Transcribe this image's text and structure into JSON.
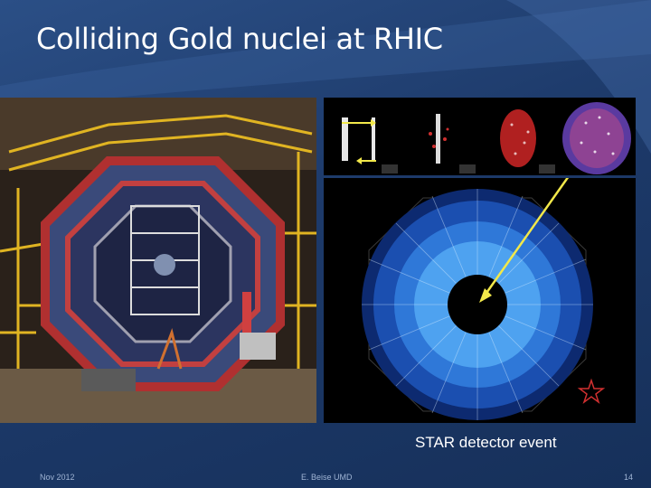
{
  "slide": {
    "title": "Colliding Gold nuclei at RHIC",
    "caption": "STAR detector event",
    "footer": {
      "date": "Nov 2012",
      "author": "E. Beise UMD",
      "page_number": "14"
    },
    "logo_text": "STAR"
  },
  "colors": {
    "background": "#1f3a66",
    "title_text": "#ffffff",
    "footer_text": "#9fb4d4",
    "arrow": "#f2e84a"
  }
}
